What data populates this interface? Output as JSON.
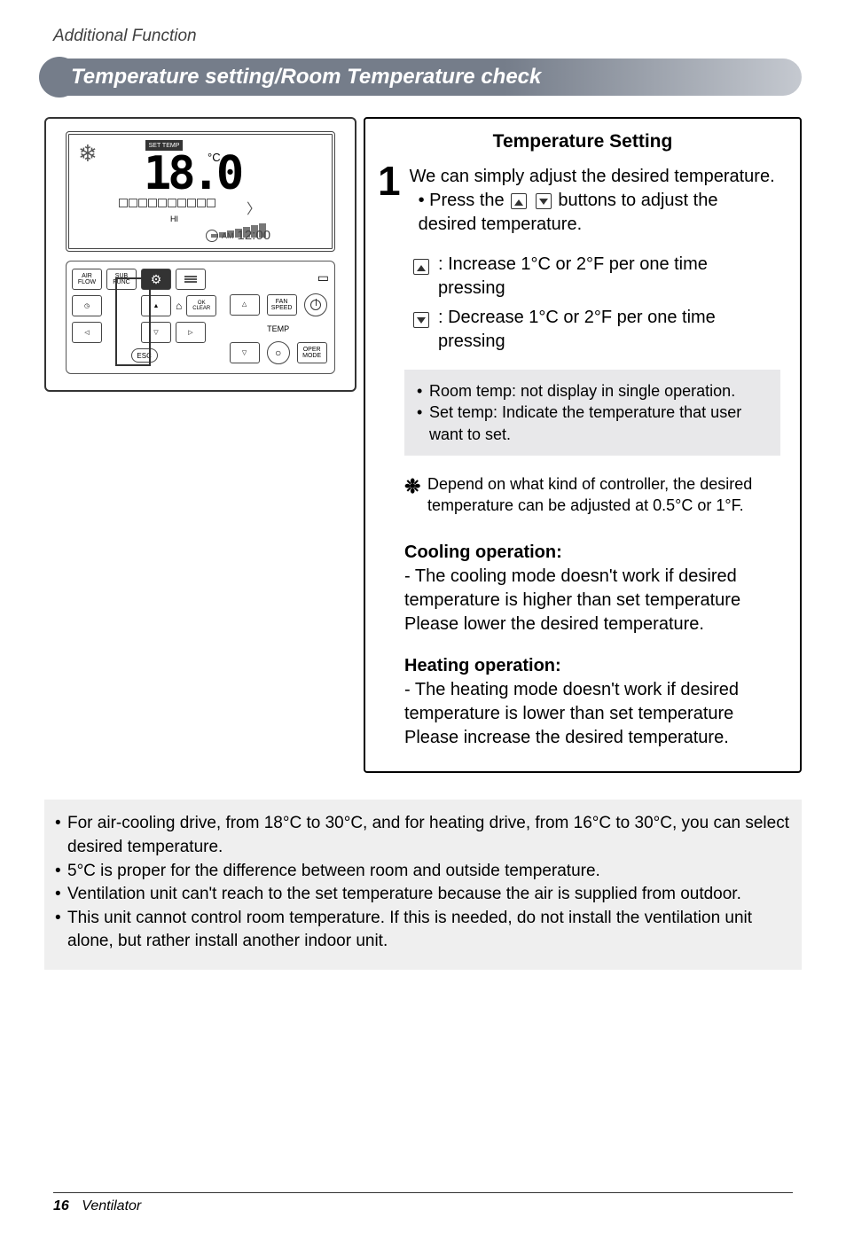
{
  "breadcrumb": "Additional Function",
  "titlebar": "Temperature setting/Room Temperature check",
  "remote": {
    "set_temp_label": "SET TEMP",
    "temp_value": "18.0",
    "temp_unit": "°C",
    "hi_label": "HI",
    "am_label": "AM",
    "clock_value": "12:00",
    "btn_air_flow": "AIR\nFLOW",
    "btn_sub_func": "SUB\nFUNC",
    "btn_vent": "VENT",
    "btn_ok_clear": "OK\nCLEAR",
    "btn_esc": "ESC",
    "lbl_fan_speed": "FAN\nSPEED",
    "lbl_temp": "TEMP",
    "lbl_oper_mode": "OPER\nMODE"
  },
  "panel": {
    "title": "Temperature Setting",
    "step_num": "1",
    "intro_line1": "We can simply adjust the desired temperature.",
    "intro_bullet": "Press the",
    "intro_bullet_tail": "buttons to adjust the desired temperature.",
    "inc_text": ": Increase 1°C or 2°F per one time pressing",
    "dec_text": ": Decrease 1°C or 2°F per one time pressing",
    "gray_room": "Room temp: not display in single operation.",
    "gray_set": "Set temp: Indicate the temperature that user want to set.",
    "footnote": "Depend on what kind of controller, the desired temperature can be adjusted at 0.5°C or 1°F.",
    "cool_head": "Cooling operation:",
    "cool_body": "- The cooling mode doesn't work if desired temperature is higher than set temperature Please lower the desired temperature.",
    "heat_head": "Heating operation:",
    "heat_body": "- The heating mode doesn't work if desired temperature is lower than set temperature Please increase the desired temperature."
  },
  "notes": {
    "n1": "For air-cooling drive, from 18°C to 30°C, and for heating drive, from 16°C to 30°C, you can select desired temperature.",
    "n2": "5°C is proper for the difference between room and outside temperature.",
    "n3": "Ventilation unit can't reach to the set temperature because the air is supplied from outdoor.",
    "n4": "This unit cannot control room temperature. If this is needed, do not install the ventilation unit alone, but rather install another indoor unit."
  },
  "footer": {
    "page": "16",
    "doc": "Ventilator"
  }
}
